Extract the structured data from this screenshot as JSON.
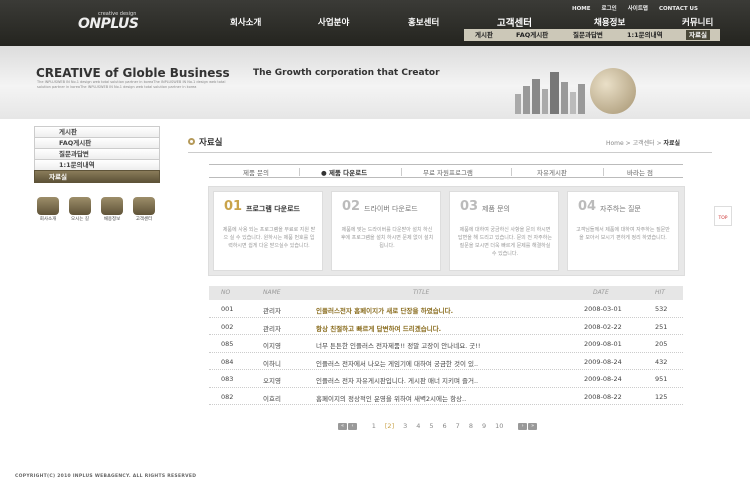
{
  "logo": {
    "small": "creative design",
    "main": "ONPLUS"
  },
  "util_menu": [
    "HOME",
    "로그인",
    "사이트맵",
    "CONTACT US"
  ],
  "main_menu": [
    "회사소개",
    "사업분야",
    "홍보센터",
    "고객센터",
    "채용정보",
    "커뮤니티"
  ],
  "sub_menu": {
    "items": [
      "게시판",
      "FAQ게시판",
      "질문과답변",
      "1:1문의내역",
      "자료실"
    ],
    "active": "자료실"
  },
  "banner": {
    "title": "CREATIVE of Globle Business",
    "tagline": "The Growth corporation that Creator",
    "fine_print": "The INPLUSWEB IN No.1 design web total solution partner in koreaThe INPLUSWEB IN No.1 design web total solution partner in koreaThe INPLUSWEB IN No.1 design web total solution partner in korea"
  },
  "lnb": {
    "items": [
      "게시판",
      "FAQ게시판",
      "질문과답변",
      "1:1문의내역",
      "자료실"
    ],
    "active_index": 4
  },
  "quick_links": [
    "회사소개",
    "오시는 길",
    "채용정보",
    "고객센터"
  ],
  "page": {
    "title": "자료실",
    "breadcrumb": [
      "Home",
      "고객센터",
      "자료실"
    ]
  },
  "tabs": {
    "items": [
      "제품 문의",
      "제품 다운로드",
      "무료 자원프로그램",
      "자유게시판",
      "바라는 점"
    ],
    "active_index": 1
  },
  "steps": [
    {
      "num": "01",
      "title": "프로그램 다운로드",
      "desc": "제품에 사용 되는 프로그램을 무료로 지원 받으 실 수 있습니다. 원하시는 제품 번호를 입력하시면 쉽게 다운 받으실수 있습니다."
    },
    {
      "num": "02",
      "title": "드라이버 다운로드",
      "desc": "제품에 맞는 드라이버를 다운받아 설치 하신 후에 프로그램을 설치 하시면 문제 없이 설치 됩니다."
    },
    {
      "num": "03",
      "title": "제품 문의",
      "desc": "제품에 대하여 궁금하신 사항을 문의 하시면 답변을 해 드리고 있습니다. 문의 전 자주하는 질문을 보시면 더욱 빠르게 문제를 해결하실 수 있습니다."
    },
    {
      "num": "04",
      "title": "자주하는 질문",
      "desc": "고객님들께서 제품에 대하여 자주하는 질문만을 모아서 보시기 편하게 정리 하였습니다."
    }
  ],
  "table": {
    "headers": [
      "NO",
      "NAME",
      "TITLE",
      "DATE",
      "HIT"
    ],
    "rows": [
      {
        "no": "001",
        "name": "관리자",
        "title": "인플러스전자 홈페이지가 새로 단장을 하였습니다.",
        "date": "2008-03-01",
        "hit": "532",
        "notice": true
      },
      {
        "no": "002",
        "name": "관리자",
        "title": "항상 친절하고 빠르게 답변하여 드리겠습니다.",
        "date": "2008-02-22",
        "hit": "251",
        "notice": true
      },
      {
        "no": "085",
        "name": "이지영",
        "title": "너무 튼튼한 인플러스 전자제품!! 정말 고장이 안나네요. 굿!!",
        "date": "2009-08-01",
        "hit": "205",
        "notice": false
      },
      {
        "no": "084",
        "name": "이하니",
        "title": "인플러스 전자에서 나오는 게임기에 대하여 궁금한 것이 있..",
        "date": "2009-08-24",
        "hit": "432",
        "notice": false
      },
      {
        "no": "083",
        "name": "오지영",
        "title": "인플러스 전자 자유게시판입니다. 게시판 매너 지키며 즐거..",
        "date": "2009-08-24",
        "hit": "951",
        "notice": false
      },
      {
        "no": "082",
        "name": "이효리",
        "title": "홈페이지의 정상적인 운영을 위하여 새벽2시에는 항상..",
        "date": "2008-08-22",
        "hit": "125",
        "notice": false
      }
    ]
  },
  "pagination": {
    "pages": [
      "1",
      "2",
      "3",
      "4",
      "5",
      "6",
      "7",
      "8",
      "9",
      "10"
    ],
    "current": "2"
  },
  "top_button": "TOP",
  "footer": "COPYRIGHT(C) 2010 INPLUS WEBAGENCY. ALL RIGHTS RESERVED",
  "colors": {
    "accent": "#c9a34a",
    "header_bg": "#2e2e29",
    "lnb_active": "#6b5f42"
  }
}
